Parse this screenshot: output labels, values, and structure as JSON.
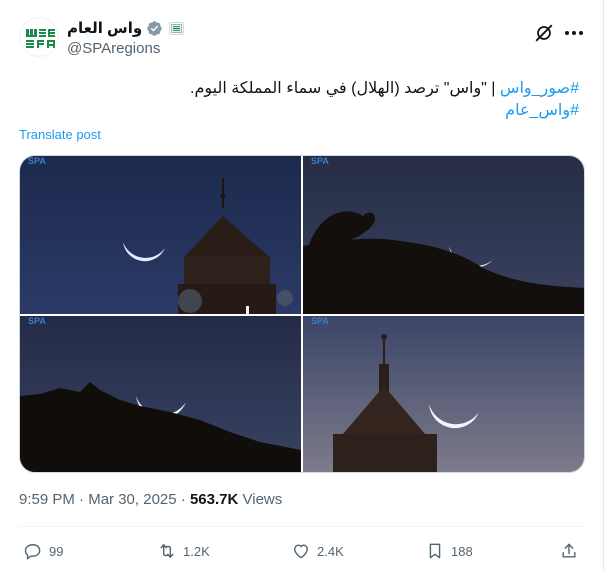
{
  "author": {
    "display_name": "واس العام",
    "handle": "@SPAregions"
  },
  "tweet": {
    "hashtag_1": "#صور_واس",
    "text": "| \"واس\" ترصد (الهلال) في سماء المملكة اليوم.",
    "hashtag_2": "#واس_عام",
    "translate_label": "Translate post"
  },
  "images": {
    "watermark": "SPA",
    "count": 4
  },
  "meta": {
    "time": "9:59 PM",
    "separator": "·",
    "date": "Mar 30, 2025",
    "views_count": "563.7K",
    "views_label": "Views"
  },
  "actions": {
    "replies": "99",
    "reposts": "1.2K",
    "likes": "2.4K",
    "bookmarks": "188"
  },
  "icons": [
    "verified-badge-icon",
    "affiliate-badge-icon",
    "grok-icon",
    "more-icon",
    "reply-icon",
    "repost-icon",
    "like-icon",
    "bookmark-icon",
    "share-icon"
  ],
  "colors": {
    "accent": "#1d9bf0",
    "text": "#0f1419",
    "muted": "#536471",
    "logo_green": "#1a8a4a"
  }
}
